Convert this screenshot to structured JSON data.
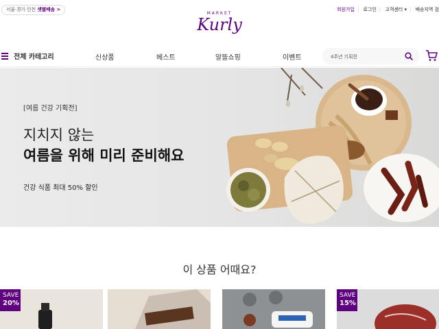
{
  "util": {
    "address_text": "서울·경기·인천",
    "delivery_text": "샛별배송 >",
    "links": [
      "회원가입",
      "로그인",
      "고객센터 ▾",
      "배송지역 검"
    ]
  },
  "logo": {
    "market": "MARKET",
    "name": "Kurly"
  },
  "nav": {
    "category": "전체 카테고리",
    "menu": [
      "신상품",
      "베스트",
      "알뜰쇼핑",
      "이벤트"
    ],
    "search_placeholder": "4주년 기획전"
  },
  "banner": {
    "tag": "[여름 건강 기획전]",
    "line1": "지치지 않는",
    "line2": "여름을 위해 미리 준비해요",
    "sub": "건강 식품 최대 50% 할인"
  },
  "section": {
    "title": "이 상품 어때요?"
  },
  "products": [
    {
      "badge_top": "SAVE",
      "badge_pct": "20%"
    },
    {
      "badge_top": "",
      "badge_pct": ""
    },
    {
      "badge_top": "",
      "badge_pct": ""
    },
    {
      "badge_top": "SAVE",
      "badge_pct": "15%"
    }
  ],
  "colors": {
    "brand": "#5f0080"
  }
}
